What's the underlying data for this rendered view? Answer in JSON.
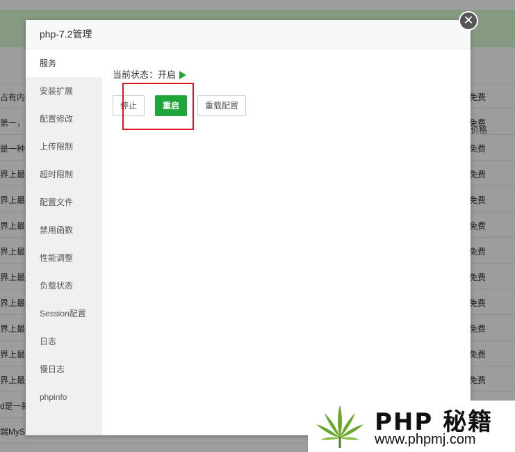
{
  "background": {
    "price_header": "价格",
    "rows": [
      {
        "left": "占有内",
        "right": "免费"
      },
      {
        "left": "第一，",
        "right": "免费"
      },
      {
        "left": "是一种关",
        "right": "免费"
      },
      {
        "left": "界上最",
        "right": "免费"
      },
      {
        "left": "界上最",
        "right": "免费"
      },
      {
        "left": "界上最",
        "right": "免费"
      },
      {
        "left": "界上最",
        "right": "免费"
      },
      {
        "left": "界上最",
        "right": "免费"
      },
      {
        "left": "界上最",
        "right": "免费"
      },
      {
        "left": "界上最",
        "right": "免费"
      },
      {
        "left": "界上最",
        "right": "免费"
      },
      {
        "left": "界上最",
        "right": "免费"
      },
      {
        "left": "d是一款",
        "right": ""
      },
      {
        "left": "端MyS",
        "right": ""
      }
    ]
  },
  "dialog": {
    "title": "php-7.2管理",
    "close_glyph": "✕",
    "sidebar": [
      "服务",
      "安装扩展",
      "配置修改",
      "上传限制",
      "超时限制",
      "配置文件",
      "禁用函数",
      "性能调整",
      "负载状态",
      "Session配置",
      "日志",
      "慢日志",
      "phpinfo"
    ],
    "active_index": 0,
    "status_label": "当前状态：开启",
    "status_icon": "play-icon",
    "buttons": {
      "stop": "停止",
      "restart": "重启",
      "reload": "重载配置"
    },
    "colors": {
      "accent": "#20a53a",
      "highlight": "#e0141e"
    }
  },
  "watermark": {
    "title": "PHP 秘籍",
    "url": "www.phpmj.com"
  }
}
